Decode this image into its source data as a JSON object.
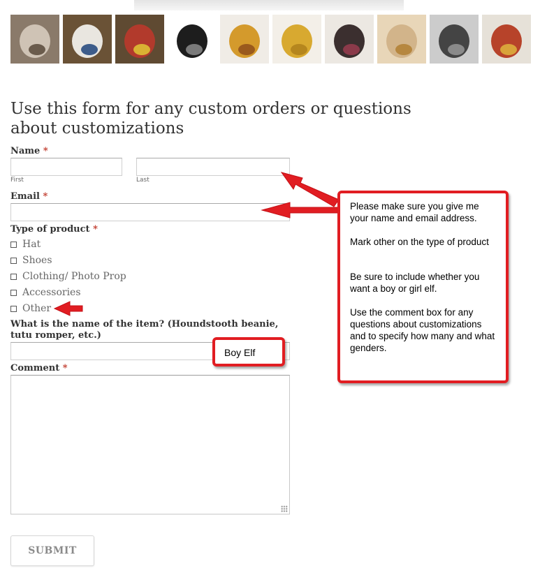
{
  "thumbnails": [
    {
      "name": "costume-thumb-1",
      "colors": [
        "#8a7a6a",
        "#cfc3b5",
        "#6a5b4c"
      ]
    },
    {
      "name": "costume-thumb-2",
      "colors": [
        "#6a5236",
        "#e9e6e0",
        "#3d5c8a"
      ]
    },
    {
      "name": "costume-thumb-3",
      "colors": [
        "#5f4a32",
        "#b23a2c",
        "#d9b233"
      ]
    },
    {
      "name": "costume-thumb-4",
      "colors": [
        "#ffffff",
        "#1d1d1d",
        "#7a7a7a"
      ]
    },
    {
      "name": "costume-thumb-5",
      "colors": [
        "#f0ece6",
        "#d49a2c",
        "#9a5a1d"
      ]
    },
    {
      "name": "costume-thumb-6",
      "colors": [
        "#f3efe8",
        "#d8a930",
        "#b5861e"
      ]
    },
    {
      "name": "costume-thumb-7",
      "colors": [
        "#ece8e2",
        "#3b2f2f",
        "#8b3a4a"
      ]
    },
    {
      "name": "costume-thumb-8",
      "colors": [
        "#e8d6b8",
        "#d2b48a",
        "#b6873f"
      ]
    },
    {
      "name": "costume-thumb-9",
      "colors": [
        "#cccccc",
        "#444444",
        "#8a8a8a"
      ]
    },
    {
      "name": "costume-thumb-10",
      "colors": [
        "#e6e1d8",
        "#b7432a",
        "#d9a33a"
      ]
    }
  ],
  "form": {
    "heading": "Use this form for any custom orders or questions about customizations",
    "name_label": "Name",
    "required_mark": "*",
    "first_sublabel": "First",
    "last_sublabel": "Last",
    "first_value": "",
    "last_value": "",
    "email_label": "Email",
    "email_value": "",
    "product_label": "Type of product",
    "product_options": [
      "Hat",
      "Shoes",
      "Clothing/ Photo Prop",
      "Accessories",
      "Other"
    ],
    "item_label": "What is the name of the item? (Houndstooth beanie, tutu romper, etc.)",
    "item_value": "",
    "comment_label": "Comment",
    "comment_value": "",
    "submit_label": "SUBMIT"
  },
  "annotations": {
    "item_callout": "Boy Elf",
    "instructions": [
      "Please make sure you give me your name and email address.",
      "Mark other on the type of product",
      "Be sure to include whether you want a boy or girl elf.",
      "Use the comment box for any questions about customizations and to specify how many and what genders."
    ],
    "accent_color": "#e11d22"
  }
}
